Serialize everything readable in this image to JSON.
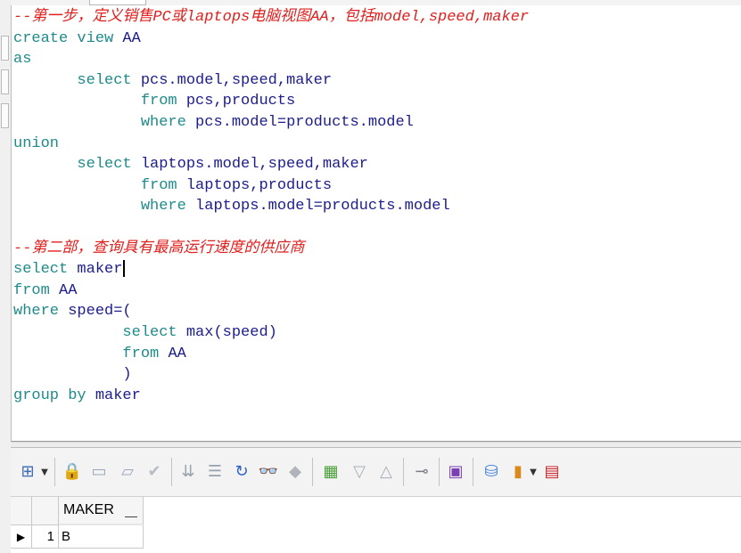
{
  "editor": {
    "lines": [
      {
        "type": "comment",
        "text": "--第一步，定义销售PC或laptops电脑视图AA，包括model,speed,maker"
      },
      {
        "type": "code",
        "kw": "create view ",
        "id": "AA"
      },
      {
        "type": "code",
        "kw": "as",
        "id": ""
      },
      {
        "type": "code",
        "kw": "       select ",
        "id": "pcs.model,speed,maker"
      },
      {
        "type": "code",
        "kw": "              from ",
        "id": "pcs,products"
      },
      {
        "type": "code",
        "kw": "              where ",
        "id": "pcs.model=products.model"
      },
      {
        "type": "code",
        "kw": "union",
        "id": ""
      },
      {
        "type": "code",
        "kw": "       select ",
        "id": "laptops.model,speed,maker"
      },
      {
        "type": "code",
        "kw": "              from ",
        "id": "laptops,products"
      },
      {
        "type": "code",
        "kw": "              where ",
        "id": "laptops.model=products.model"
      },
      {
        "type": "blank",
        "text": ""
      },
      {
        "type": "comment",
        "text": "--第二部，查询具有最高运行速度的供应商"
      },
      {
        "type": "code",
        "kw": "select ",
        "id": "maker",
        "caret": true
      },
      {
        "type": "code",
        "kw": "from ",
        "id": "AA"
      },
      {
        "type": "code",
        "kw": "where ",
        "id": "speed=("
      },
      {
        "type": "code",
        "kw": "            select ",
        "id": "max(speed)"
      },
      {
        "type": "code",
        "kw": "            from ",
        "id": "AA"
      },
      {
        "type": "code",
        "kw": "            ",
        "id": ")"
      },
      {
        "type": "code",
        "kw": "group by ",
        "id": "maker"
      }
    ]
  },
  "toolbar": {
    "icons": [
      {
        "name": "grid-select-icon",
        "glyph": "⊞",
        "color": "#3a6bb5"
      },
      {
        "name": "lock-icon",
        "glyph": "🔒",
        "color": "#c0262b"
      },
      {
        "name": "new-record-icon",
        "glyph": "▭",
        "color": "#9aa7b8"
      },
      {
        "name": "comment-icon",
        "glyph": "▱",
        "color": "#9aa7b8"
      },
      {
        "name": "checkmark-icon",
        "glyph": "✔",
        "color": "#b8bcc4"
      },
      {
        "name": "sort-descending-icon",
        "glyph": "⇊",
        "color": "#9aa2ad"
      },
      {
        "name": "filter-icon",
        "glyph": "☰",
        "color": "#9aa2ad"
      },
      {
        "name": "refresh-icon",
        "glyph": "↻",
        "color": "#2b64c4"
      },
      {
        "name": "find-icon",
        "glyph": "👓",
        "color": "#2b4d8c"
      },
      {
        "name": "eraser-icon",
        "glyph": "◆",
        "color": "#b0b4ba"
      },
      {
        "name": "export-icon",
        "glyph": "▦",
        "color": "#4a9f3a"
      },
      {
        "name": "arrow-down-icon",
        "glyph": "▽",
        "color": "#a8adb6"
      },
      {
        "name": "arrow-up-icon",
        "glyph": "△",
        "color": "#a8adb6"
      },
      {
        "name": "tree-view-icon",
        "glyph": "⊸",
        "color": "#7a7f88"
      },
      {
        "name": "save-icon",
        "glyph": "▣",
        "color": "#7a3fb0"
      },
      {
        "name": "database-add-icon",
        "glyph": "⛁",
        "color": "#3d7ad6"
      },
      {
        "name": "chart-icon",
        "glyph": "▮",
        "color": "#d98a1a"
      },
      {
        "name": "spreadsheet-icon",
        "glyph": "▤",
        "color": "#c8262b"
      }
    ]
  },
  "results": {
    "columns": [
      "MAKER"
    ],
    "rows": [
      {
        "num": "1",
        "maker": "B"
      }
    ]
  }
}
